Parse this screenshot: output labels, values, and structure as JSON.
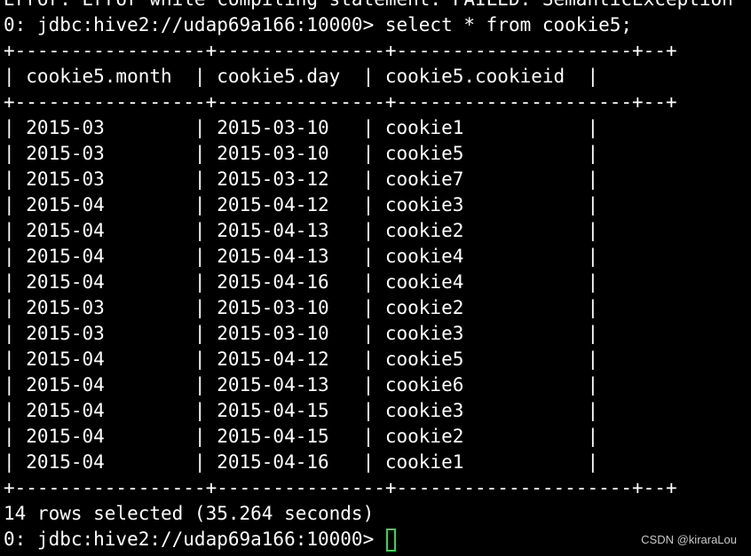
{
  "terminal": {
    "error_line": "Error: Error while compiling statement: FAILED: SemanticException",
    "query_prompt": "0: jdbc:hive2://udap69a166:10000> select * from cookie5;",
    "border_line": "+-----------------+---------------+---------------------+--+",
    "header_row": "| cookie5.month  | cookie5.day  | cookie5.cookieid  |",
    "rows": [
      "| 2015-03        | 2015-03-10   | cookie1           |",
      "| 2015-03        | 2015-03-10   | cookie5           |",
      "| 2015-03        | 2015-03-12   | cookie7           |",
      "| 2015-04        | 2015-04-12   | cookie3           |",
      "| 2015-04        | 2015-04-13   | cookie2           |",
      "| 2015-04        | 2015-04-13   | cookie4           |",
      "| 2015-04        | 2015-04-16   | cookie4           |",
      "| 2015-03        | 2015-03-10   | cookie2           |",
      "| 2015-03        | 2015-03-10   | cookie3           |",
      "| 2015-04        | 2015-04-12   | cookie5           |",
      "| 2015-04        | 2015-04-13   | cookie6           |",
      "| 2015-04        | 2015-04-15   | cookie3           |",
      "| 2015-04        | 2015-04-15   | cookie2           |",
      "| 2015-04        | 2015-04-16   | cookie1           |"
    ],
    "summary": "14 rows selected (35.264 seconds)",
    "current_prompt": "0: jdbc:hive2://udap69a166:10000> "
  },
  "watermark": "CSDN @kiraraLou",
  "colors": {
    "background": "#000000",
    "text": "#ffffff",
    "cursor": "#39d353"
  }
}
